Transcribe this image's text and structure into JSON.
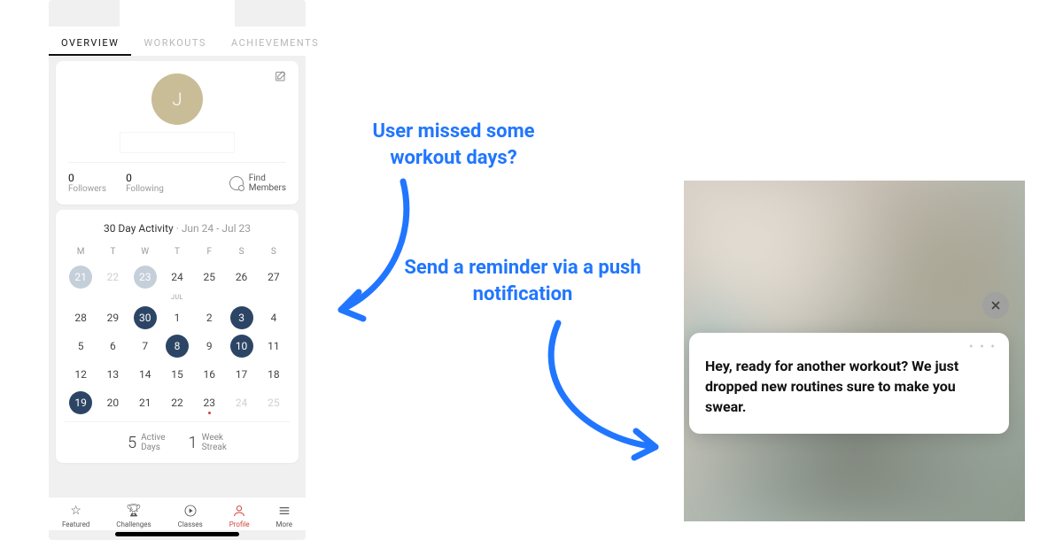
{
  "tabs": {
    "overview": "OVERVIEW",
    "workouts": "WORKOUTS",
    "achievements": "ACHIEVEMENTS"
  },
  "profile": {
    "avatar_initial": "J",
    "followers_count": "0",
    "followers_label": "Followers",
    "following_count": "0",
    "following_label": "Following",
    "find_members_1": "Find",
    "find_members_2": "Members"
  },
  "calendar": {
    "title": "30 Day Activity",
    "range": "Jun 24 - Jul 23",
    "dow": [
      "M",
      "T",
      "W",
      "T",
      "F",
      "S",
      "S"
    ],
    "month_jul": "JUL",
    "rows": [
      [
        {
          "d": "21",
          "s": "light"
        },
        {
          "d": "22",
          "s": "out"
        },
        {
          "d": "23",
          "s": "light"
        },
        {
          "d": "24",
          "s": ""
        },
        {
          "d": "25",
          "s": ""
        },
        {
          "d": "26",
          "s": ""
        },
        {
          "d": "27",
          "s": ""
        }
      ],
      [
        {
          "d": "28",
          "s": ""
        },
        {
          "d": "29",
          "s": ""
        },
        {
          "d": "30",
          "s": "dark"
        },
        {
          "d": "1",
          "s": ""
        },
        {
          "d": "2",
          "s": ""
        },
        {
          "d": "3",
          "s": "dark"
        },
        {
          "d": "4",
          "s": ""
        }
      ],
      [
        {
          "d": "5",
          "s": ""
        },
        {
          "d": "6",
          "s": ""
        },
        {
          "d": "7",
          "s": ""
        },
        {
          "d": "8",
          "s": "dark"
        },
        {
          "d": "9",
          "s": ""
        },
        {
          "d": "10",
          "s": "dark"
        },
        {
          "d": "11",
          "s": ""
        }
      ],
      [
        {
          "d": "12",
          "s": ""
        },
        {
          "d": "13",
          "s": ""
        },
        {
          "d": "14",
          "s": ""
        },
        {
          "d": "15",
          "s": ""
        },
        {
          "d": "16",
          "s": ""
        },
        {
          "d": "17",
          "s": ""
        },
        {
          "d": "18",
          "s": ""
        }
      ],
      [
        {
          "d": "19",
          "s": "dark"
        },
        {
          "d": "20",
          "s": ""
        },
        {
          "d": "21",
          "s": ""
        },
        {
          "d": "22",
          "s": ""
        },
        {
          "d": "23",
          "s": "",
          "today": true
        },
        {
          "d": "24",
          "s": "out"
        },
        {
          "d": "25",
          "s": "out"
        }
      ]
    ],
    "active_days_n": "5",
    "active_days_l1": "Active",
    "active_days_l2": "Days",
    "week_streak_n": "1",
    "week_streak_l1": "Week",
    "week_streak_l2": "Streak"
  },
  "nav": {
    "featured": "Featured",
    "challenges": "Challenges",
    "classes": "Classes",
    "profile": "Profile",
    "more": "More"
  },
  "annotations": {
    "a1": "User missed some workout days?",
    "a2": "Send a reminder via a push notification"
  },
  "notification": {
    "dots": "• • •",
    "text": "Hey, ready for another workout? We just dropped new routines sure to make you swear."
  }
}
